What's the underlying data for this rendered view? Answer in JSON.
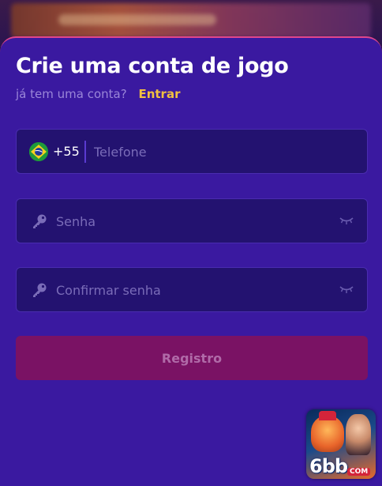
{
  "form": {
    "title": "Crie uma conta de jogo",
    "have_account_text": "já tem uma conta?",
    "login_link": "Entrar",
    "phone": {
      "country_icon": "brazil-flag-icon",
      "dial_code": "+55",
      "placeholder": "Telefone",
      "value": ""
    },
    "password": {
      "placeholder": "Senha",
      "value": "",
      "icon": "key-icon",
      "toggle_icon": "eye-closed-icon"
    },
    "confirm_password": {
      "placeholder": "Confirmar senha",
      "value": "",
      "icon": "key-icon",
      "toggle_icon": "eye-closed-icon"
    },
    "submit_label": "Registro"
  },
  "badge": {
    "logo_main": "6bb",
    "logo_sub": "COM"
  },
  "colors": {
    "sheet_bg": "#3a19a0",
    "field_bg": "#231270",
    "accent_link": "#f0c040",
    "button_bg": "#7a1264",
    "button_text": "#b06aa8",
    "top_border": "#e0468c"
  }
}
